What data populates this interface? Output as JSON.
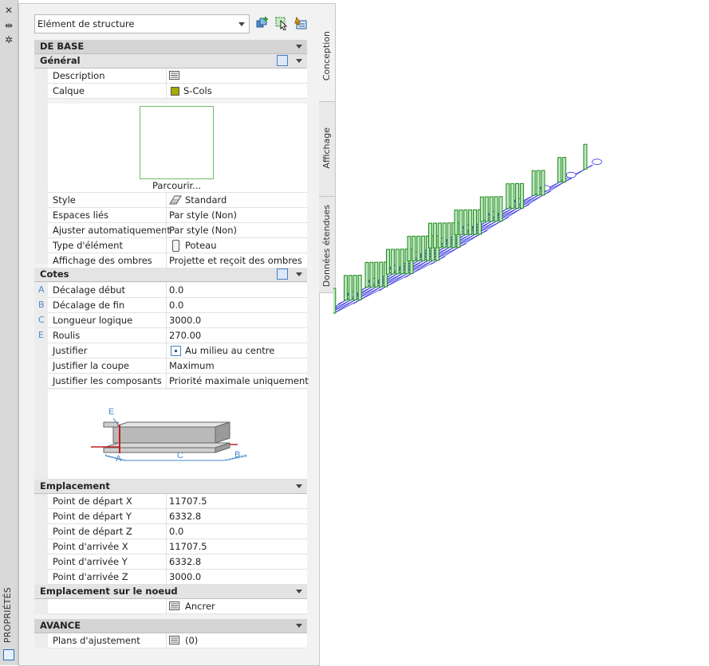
{
  "palette": {
    "title": "PROPRIÉTÉS",
    "tabs": {
      "conception": "Conception",
      "affichage": "Affichage",
      "donnees": "Données étendues"
    }
  },
  "selector": {
    "value": "Elément de structure"
  },
  "sections": {
    "de_base": "DE BASE",
    "general": "Général",
    "cotes": "Cotes",
    "emplacement": "Emplacement",
    "emplacement_noeud": "Emplacement sur le noeud",
    "avance": "AVANCE"
  },
  "general": {
    "description": {
      "label": "Description"
    },
    "calque": {
      "label": "Calque",
      "value": "S-Cols",
      "color": "#a8a800"
    },
    "preview_caption": "Parcourir...",
    "style": {
      "label": "Style",
      "value": "Standard"
    },
    "espaces_lies": {
      "label": "Espaces liés",
      "value": "Par style (Non)"
    },
    "ajuster": {
      "label": "Ajuster automatiquement",
      "value": "Par style (Non)"
    },
    "type_element": {
      "label": "Type d'élément",
      "value": "Poteau"
    },
    "ombres": {
      "label": "Affichage des ombres",
      "value": "Projette et reçoit des ombres"
    }
  },
  "cotes": {
    "decalage_debut": {
      "key": "A",
      "label": "Décalage début",
      "value": "0.0"
    },
    "decalage_fin": {
      "key": "B",
      "label": "Décalage de fin",
      "value": "0.0"
    },
    "longueur": {
      "key": "C",
      "label": "Longueur logique",
      "value": "3000.0"
    },
    "roulis": {
      "key": "E",
      "label": "Roulis",
      "value": "270.00"
    },
    "justifier": {
      "label": "Justifier",
      "value": "Au milieu au centre"
    },
    "justifier_coupe": {
      "label": "Justifier la coupe",
      "value": "Maximum"
    },
    "justifier_composants": {
      "label": "Justifier les composants",
      "value": "Priorité maximale uniquement"
    },
    "diagram_labels": {
      "a": "A",
      "b": "B",
      "c": "C",
      "e": "E"
    }
  },
  "emplacement": {
    "dx": {
      "label": "Point de départ X",
      "value": "11707.5"
    },
    "dy": {
      "label": "Point de départ Y",
      "value": "6332.8"
    },
    "dz": {
      "label": "Point de départ Z",
      "value": "0.0"
    },
    "ax": {
      "label": "Point d'arrivée X",
      "value": "11707.5"
    },
    "ay": {
      "label": "Point d'arrivée Y",
      "value": "6332.8"
    },
    "az": {
      "label": "Point d'arrivée Z",
      "value": "3000.0"
    }
  },
  "noeud": {
    "value": "Ancrer"
  },
  "avance": {
    "plans": {
      "label": "Plans d'ajustement",
      "value": "(0)"
    }
  },
  "colors": {
    "grid_line": "#3a3ae0",
    "column": "#1e8a1e",
    "bubble": "#3a3ae0"
  }
}
